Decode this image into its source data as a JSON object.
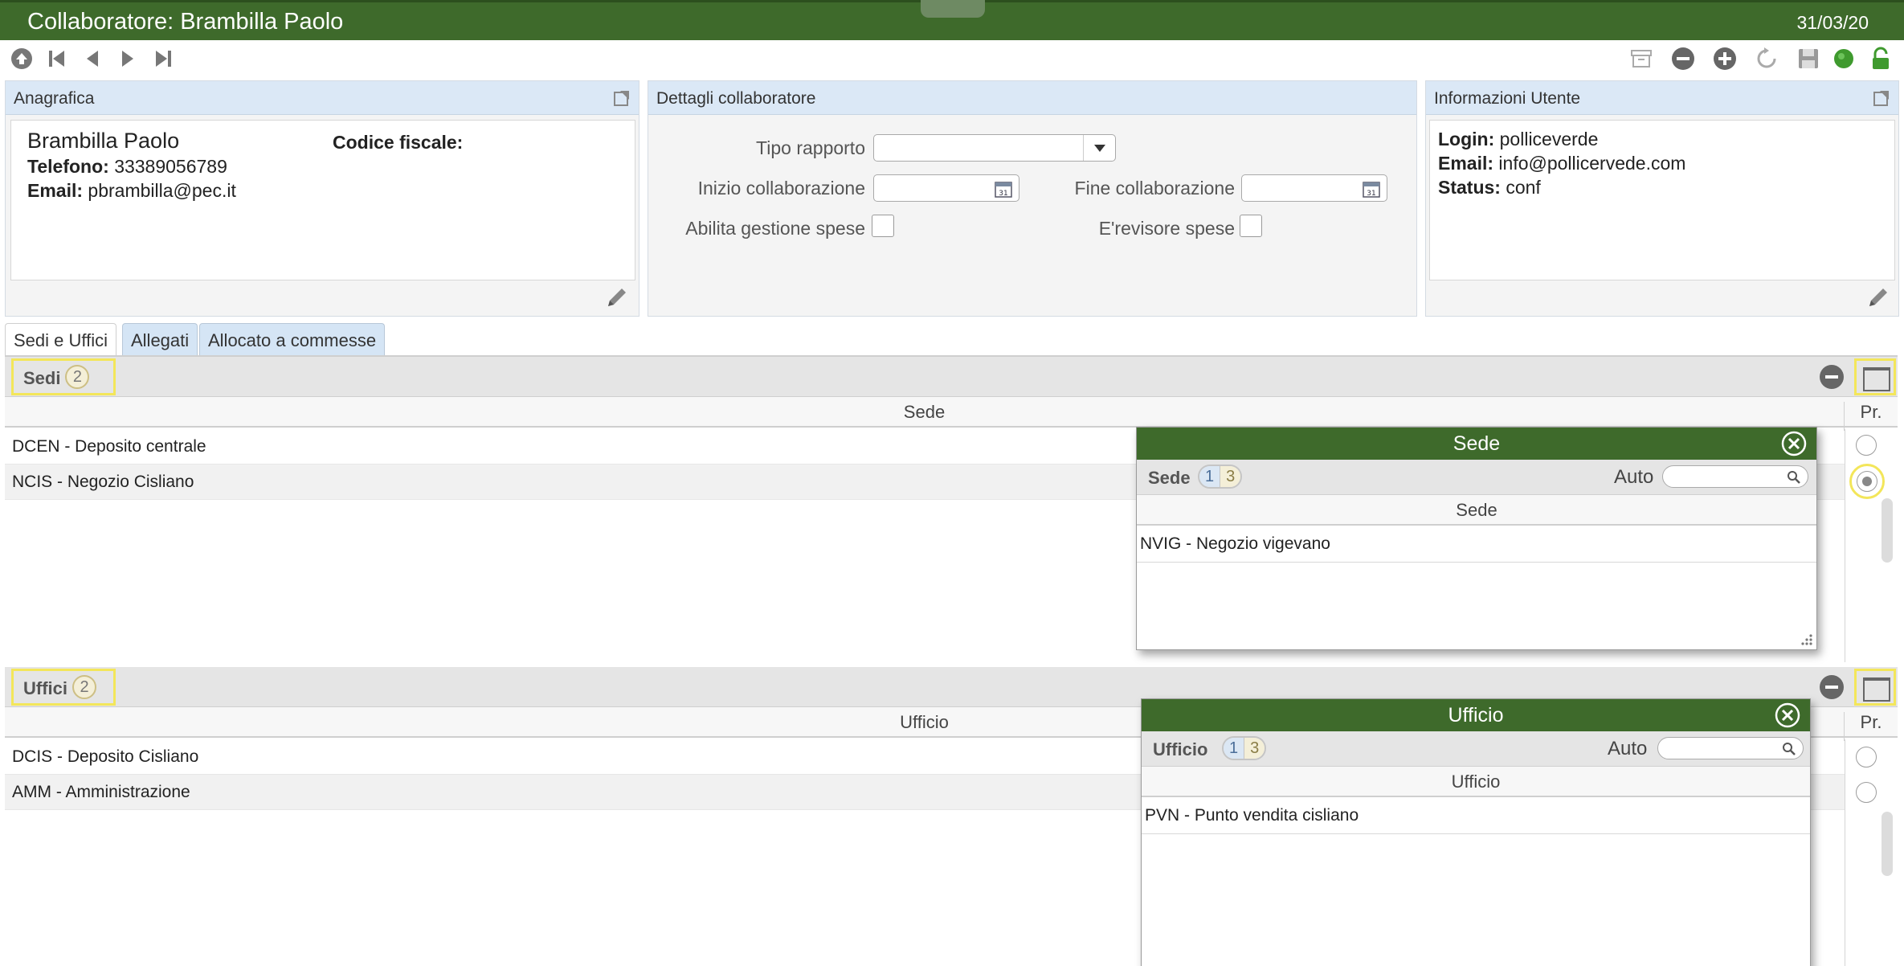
{
  "window": {
    "title": "Collaboratore: Brambilla Paolo",
    "date": "31/03/20"
  },
  "toolbar": {
    "left_icons": [
      "home-icon",
      "first-record-icon",
      "prev-record-icon",
      "next-record-icon",
      "last-record-icon"
    ],
    "right_icons": [
      "archive-icon",
      "delete-icon",
      "add-icon",
      "refresh-icon",
      "save-icon",
      "status-dot-icon",
      "unlock-icon"
    ]
  },
  "anagrafica": {
    "header": "Anagrafica",
    "name": "Brambilla Paolo",
    "telefono_label": "Telefono:",
    "telefono": "33389056789",
    "email_label": "Email:",
    "email": "pbrambilla@pec.it",
    "cf_label": "Codice fiscale:"
  },
  "dettagli": {
    "header": "Dettagli collaboratore",
    "tipo_label": "Tipo rapporto",
    "tipo_value": "",
    "inizio_label": "Inizio collaborazione",
    "inizio_value": "",
    "fine_label": "Fine collaborazione",
    "fine_value": "",
    "abilita_label": "Abilita gestione spese",
    "revisore_label": "E'revisore spese"
  },
  "info_utente": {
    "header": "Informazioni Utente",
    "login_label": "Login:",
    "login": "polliceverde",
    "email_label": "Email:",
    "email": "info@pollicervede.com",
    "status_label": "Status:",
    "status": "conf"
  },
  "tabs": [
    {
      "label": "Sedi e Uffici",
      "active": true
    },
    {
      "label": "Allegati",
      "active": false
    },
    {
      "label": "Allocato a commesse",
      "active": false
    }
  ],
  "sedi": {
    "title": "Sedi",
    "count": "2",
    "col_main": "Sede",
    "col_pr": "Pr.",
    "rows": [
      {
        "label": "DCEN - Deposito centrale",
        "principale": false
      },
      {
        "label": "NCIS - Negozio Cisliano",
        "principale": true
      }
    ]
  },
  "uffici": {
    "title": "Uffici",
    "count": "2",
    "col_main": "Ufficio",
    "col_pr": "Pr.",
    "rows": [
      {
        "label": "DCIS - Deposito Cisliano",
        "principale": false
      },
      {
        "label": "AMM - Amministrazione",
        "principale": false
      }
    ]
  },
  "popup_sede": {
    "title": "Sede",
    "label": "Sede",
    "page_current": "1",
    "page_total": "3",
    "auto_label": "Auto",
    "search_value": "",
    "col": "Sede",
    "rows": [
      "NVIG - Negozio vigevano"
    ]
  },
  "popup_ufficio": {
    "title": "Ufficio",
    "label": "Ufficio",
    "page_current": "1",
    "page_total": "3",
    "auto_label": "Auto",
    "search_value": "",
    "col": "Ufficio",
    "rows": [
      "PVN - Punto vendita cisliano"
    ]
  },
  "colors": {
    "brand_green": "#3e6a2b",
    "panel_header": "#dbe8f6",
    "highlight": "#f3e65a"
  }
}
